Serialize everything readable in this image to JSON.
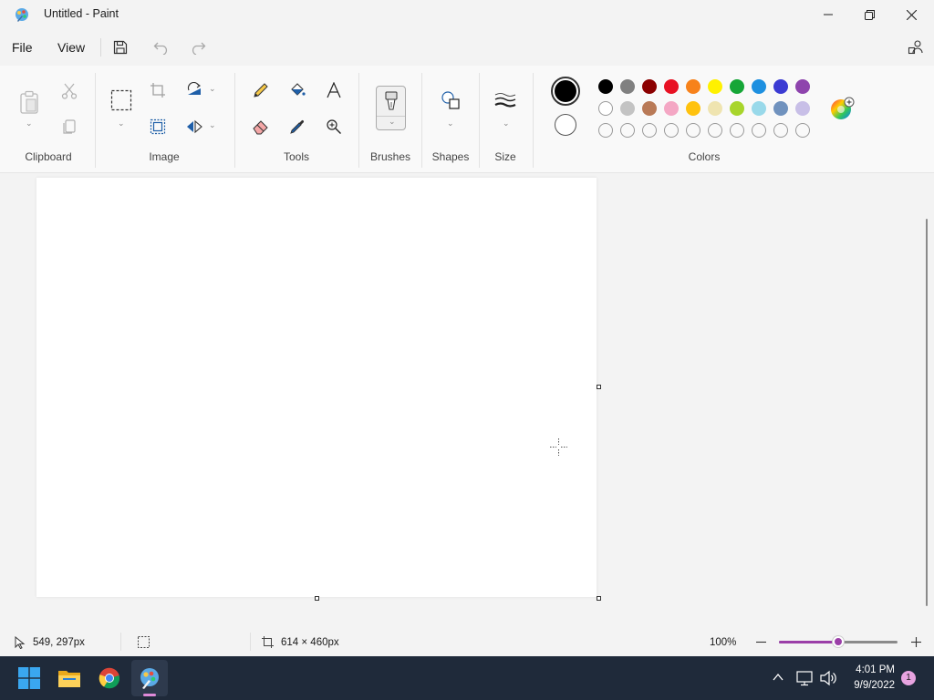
{
  "window": {
    "title": "Untitled - Paint",
    "controls": {
      "minimize": "minimize-icon",
      "restore": "restore-icon",
      "close": "close-icon"
    }
  },
  "menu": {
    "file": "File",
    "view": "View",
    "icons": [
      "save-icon",
      "undo-icon",
      "redo-icon",
      "share-icon"
    ]
  },
  "ribbon": {
    "groups": {
      "clipboard": "Clipboard",
      "image": "Image",
      "tools": "Tools",
      "brushes": "Brushes",
      "shapes": "Shapes",
      "size": "Size",
      "colors": "Colors"
    }
  },
  "colors": {
    "primary": "#000000",
    "secondary": "#ffffff",
    "palette_row1": [
      "#000000",
      "#808080",
      "#8b0000",
      "#e81123",
      "#f7821b",
      "#fff100",
      "#16a637",
      "#1e90e0",
      "#3b3bd3",
      "#8e44ad"
    ],
    "palette_row2": [
      "#ffffff",
      "#c3c3c3",
      "#b97a57",
      "#f4a7c4",
      "#ffc20e",
      "#efe4b0",
      "#a8d52b",
      "#99d9ea",
      "#7092be",
      "#c8bfe7"
    ],
    "palette_row3_empty_count_label": "custom colors (empty)"
  },
  "status": {
    "cursor_position": "549, 297px",
    "canvas_size": "614 × 460px",
    "zoom": "100%",
    "zoom_slider_fraction": 0.5
  },
  "taskbar": {
    "apps": [
      "start-icon",
      "file-explorer-icon",
      "chrome-icon",
      "paint-icon"
    ],
    "time": "4:01 PM",
    "date": "9/9/2022",
    "notification_count": "1"
  }
}
